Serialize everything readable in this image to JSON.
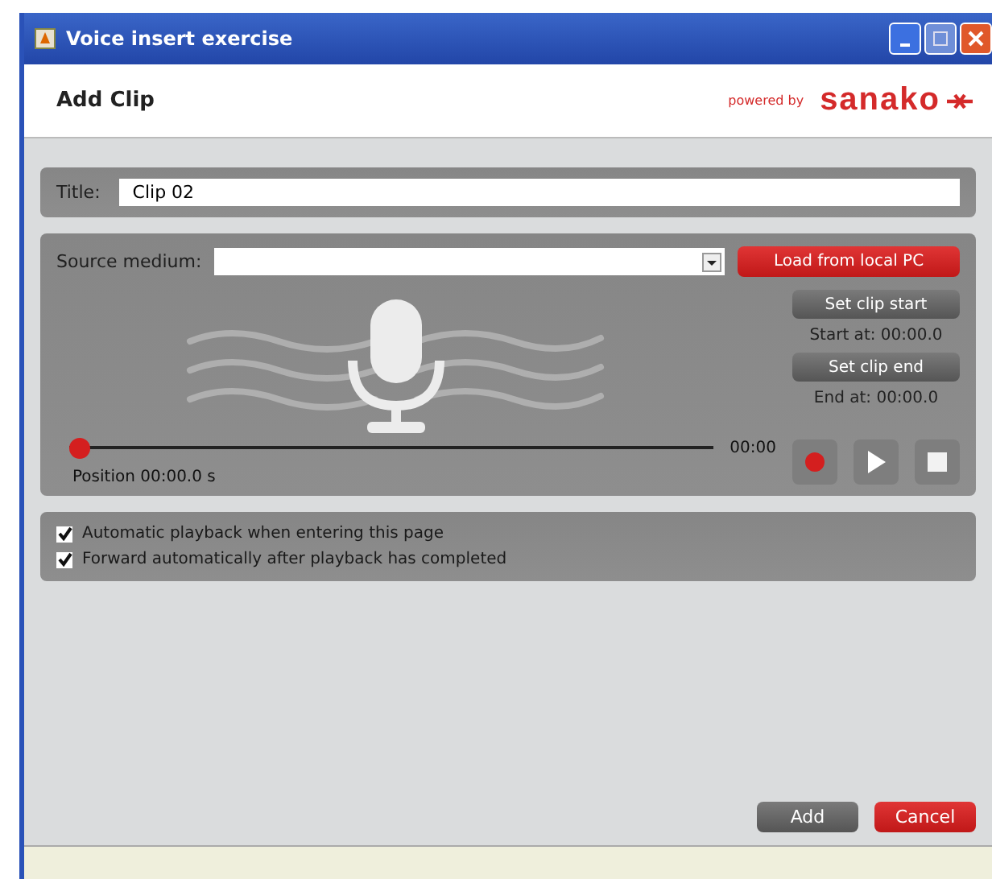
{
  "window": {
    "title": "Voice insert exercise"
  },
  "header": {
    "title": "Add Clip",
    "powered_by": "powered by",
    "brand": "sanako"
  },
  "title_field": {
    "label": "Title:",
    "value": "Clip 02"
  },
  "source": {
    "label": "Source medium:",
    "load_button": "Load from local PC"
  },
  "clip": {
    "set_start_button": "Set clip start",
    "start_at": "Start at: 00:00.0",
    "set_end_button": "Set clip end",
    "end_at": "End at: 00:00.0"
  },
  "player": {
    "level": 0,
    "time": "00:00",
    "position": "Position 00:00.0 s"
  },
  "options": [
    {
      "label": "Automatic playback when entering this page",
      "checked": true
    },
    {
      "label": "Forward automatically after playback has completed",
      "checked": true
    }
  ],
  "buttons": [
    {
      "label": "Add",
      "kind": "primary"
    },
    {
      "label": "Cancel",
      "kind": "danger"
    }
  ]
}
